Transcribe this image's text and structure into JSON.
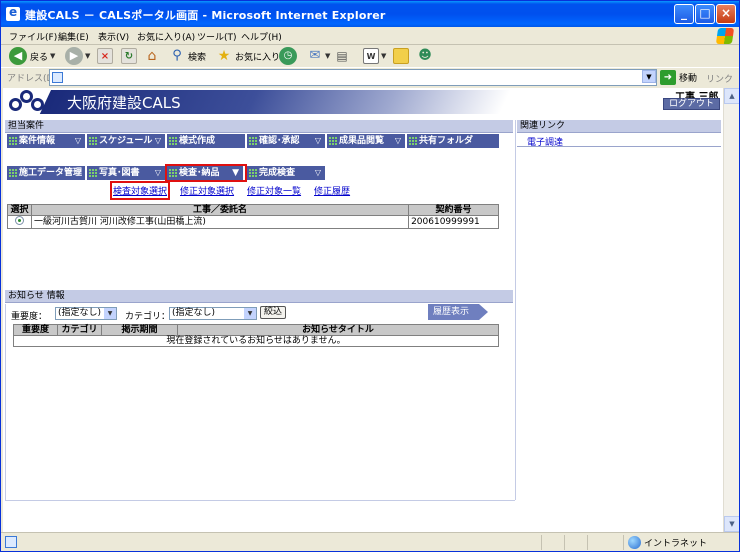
{
  "window": {
    "title": "建設CALS － CALSポータル画面 - Microsoft Internet Explorer"
  },
  "menu": [
    "ファイル(F)",
    "編集(E)",
    "表示(V)",
    "お気に入り(A)",
    "ツール(T)",
    "ヘルプ(H)"
  ],
  "toolbar": {
    "back": "戻る",
    "search": "検索",
    "favorites": "お気に入り"
  },
  "address": {
    "label": "アドレス(D)",
    "value": "",
    "go": "移動",
    "links": "リンク"
  },
  "header": {
    "title": "大阪府建設CALS",
    "user": "工事 三郎",
    "logout": "ログアウト"
  },
  "cases": {
    "title": "担当案件",
    "nav1": [
      "案件情報",
      "スケジュール",
      "様式作成",
      "確認･承認",
      "成果品閲覧",
      "共有フォルダ"
    ],
    "nav2": [
      "施工データ管理",
      "写真･図書",
      "検査･納品",
      "完成検査"
    ],
    "subnav": [
      "検査対象選択",
      "修正対象選択",
      "修正対象一覧",
      "修正履歴"
    ],
    "table": {
      "headers": [
        "選択",
        "工事／委託名",
        "契約番号"
      ],
      "rows": [
        {
          "name": "一級河川古賀川 河川改修工事(山田橋上流)",
          "number": "200610999991"
        }
      ]
    }
  },
  "related": {
    "title": "関連リンク",
    "link": "電子調達"
  },
  "notices": {
    "title": "お知らせ 情報",
    "importance_label": "重要度：",
    "importance_value": "(指定なし)",
    "category_label": "カテゴリ：",
    "category_value": "(指定なし)",
    "filter": "絞込",
    "history": "履歴表示",
    "headers": [
      "重要度",
      "カテゴリ",
      "掲示期間",
      "お知らせタイトル"
    ],
    "empty": "現在登録されているお知らせはありません。"
  },
  "status": {
    "zone": "イントラネット"
  },
  "colors": {
    "titlebar": "#0053ee",
    "nav": "#4a5aa0",
    "selected_outline": "#e01010",
    "link": "#0000cc"
  }
}
